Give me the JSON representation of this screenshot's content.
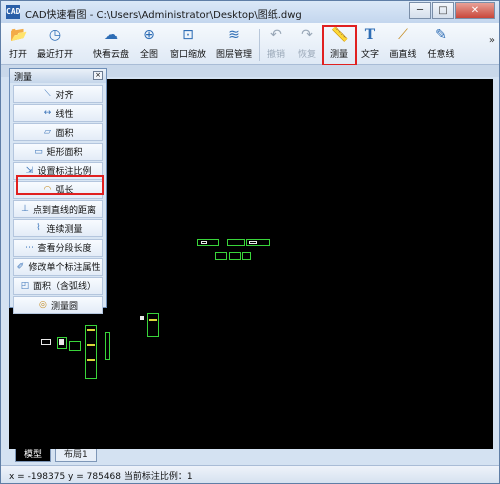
{
  "window": {
    "app_icon": "CAD",
    "title": "CAD快速看图 - C:\\Users\\Administrator\\Desktop\\图纸.dwg",
    "buttons": {
      "minimize": "─",
      "maximize": "□",
      "close": "✕"
    }
  },
  "toolbar": {
    "items": [
      {
        "label": "打开",
        "icon": "folder-icon",
        "glyph": "📂"
      },
      {
        "label": "最近打开",
        "icon": "clock-icon",
        "glyph": "◷"
      },
      {
        "label": "快看云盘",
        "icon": "cloud-icon",
        "glyph": "☁"
      },
      {
        "label": "全图",
        "icon": "fit-view-icon",
        "glyph": "⊕"
      },
      {
        "label": "窗口缩放",
        "icon": "zoom-window-icon",
        "glyph": "⊡"
      },
      {
        "label": "图层管理",
        "icon": "layers-icon",
        "glyph": "≋"
      },
      {
        "label": "撤销",
        "icon": "undo-icon",
        "glyph": "↶",
        "disabled": true
      },
      {
        "label": "恢复",
        "icon": "redo-icon",
        "glyph": "↷",
        "disabled": true
      },
      {
        "label": "测量",
        "icon": "ruler-icon",
        "glyph": "📏"
      },
      {
        "label": "文字",
        "icon": "text-icon",
        "glyph": "T"
      },
      {
        "label": "画直线",
        "icon": "line-icon",
        "glyph": "⟋"
      },
      {
        "label": "任意线",
        "icon": "pencil-icon",
        "glyph": "✎"
      }
    ],
    "more": "»"
  },
  "measure_panel": {
    "title": "测量",
    "close": "×",
    "items": [
      {
        "label": "对齐",
        "icon": "align-dimension-icon",
        "glyph": "⟍"
      },
      {
        "label": "线性",
        "icon": "linear-dimension-icon",
        "glyph": "↔"
      },
      {
        "label": "面积",
        "icon": "area-icon",
        "glyph": "▱"
      },
      {
        "label": "矩形面积",
        "icon": "rect-area-icon",
        "glyph": "▭"
      },
      {
        "label": "设置标注比例",
        "icon": "scale-icon",
        "glyph": "⇲"
      },
      {
        "label": "弧长",
        "icon": "arc-length-icon",
        "glyph": "◠"
      },
      {
        "label": "点到直线的距离",
        "icon": "point-line-distance-icon",
        "glyph": "⊥"
      },
      {
        "label": "连续测量",
        "icon": "continuous-measure-icon",
        "glyph": "⌇"
      },
      {
        "label": "查看分段长度",
        "icon": "segment-length-icon",
        "glyph": "⋯"
      },
      {
        "label": "修改单个标注属性",
        "icon": "edit-dimension-icon",
        "glyph": "✐"
      },
      {
        "label": "面积（含弧线）",
        "icon": "arc-area-icon",
        "glyph": "◰"
      },
      {
        "label": "测量圆",
        "icon": "circle-measure-icon",
        "glyph": "◎"
      }
    ]
  },
  "tabs": [
    {
      "label": "模型",
      "active": true
    },
    {
      "label": "布局1",
      "active": false
    }
  ],
  "status": {
    "text": "x = -198375  y = 785468  当前标注比例：1"
  },
  "colors": {
    "canvas": "#000000",
    "cad_green": "#39d43a",
    "highlight_red": "#e02020",
    "accent_blue": "#2e6db5"
  }
}
